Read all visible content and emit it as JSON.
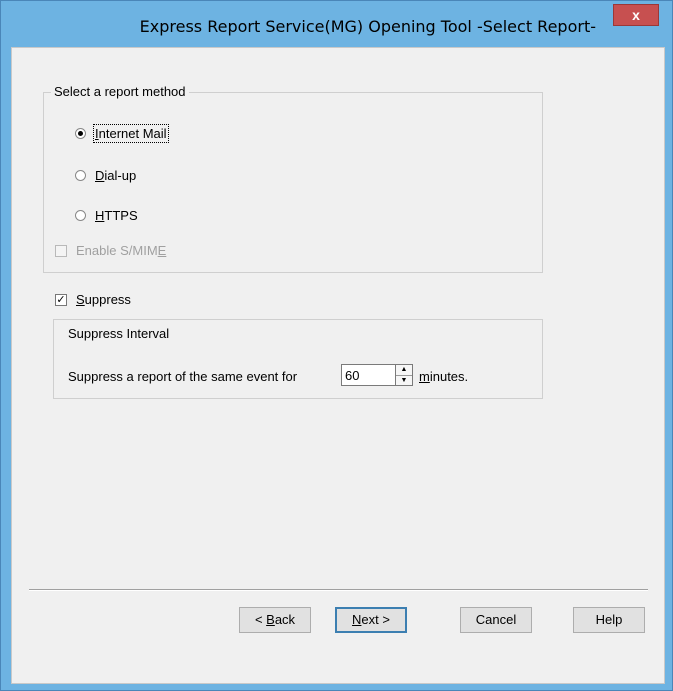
{
  "window": {
    "title": "Express Report Service(MG)  Opening Tool  -Select Report-",
    "close_glyph": "x"
  },
  "method_group": {
    "legend": "Select a report method",
    "options": [
      {
        "pre": "",
        "ul": "I",
        "post": "nternet Mail",
        "selected": true
      },
      {
        "pre": "",
        "ul": "D",
        "post": "ial-up",
        "selected": false
      },
      {
        "pre": "",
        "ul": "H",
        "post": "TTPS",
        "selected": false
      }
    ],
    "smime": {
      "pre": "Enable S/MIM",
      "ul": "E",
      "post": "",
      "checked": false,
      "enabled": false
    }
  },
  "suppress": {
    "pre": "",
    "ul": "S",
    "post": "uppress",
    "checked": true,
    "check_glyph": "✓",
    "group_title": "Suppress Interval",
    "row_label": "Suppress a report of the same event for",
    "interval_value": "60",
    "unit": {
      "pre": "",
      "ul": "m",
      "post": "inutes."
    },
    "spin_up": "▲",
    "spin_down": "▼"
  },
  "buttons": {
    "back": {
      "pre": "< ",
      "ul": "B",
      "post": "ack"
    },
    "next": {
      "pre": "",
      "ul": "N",
      "post": "ext >"
    },
    "cancel": "Cancel",
    "help": "Help"
  }
}
